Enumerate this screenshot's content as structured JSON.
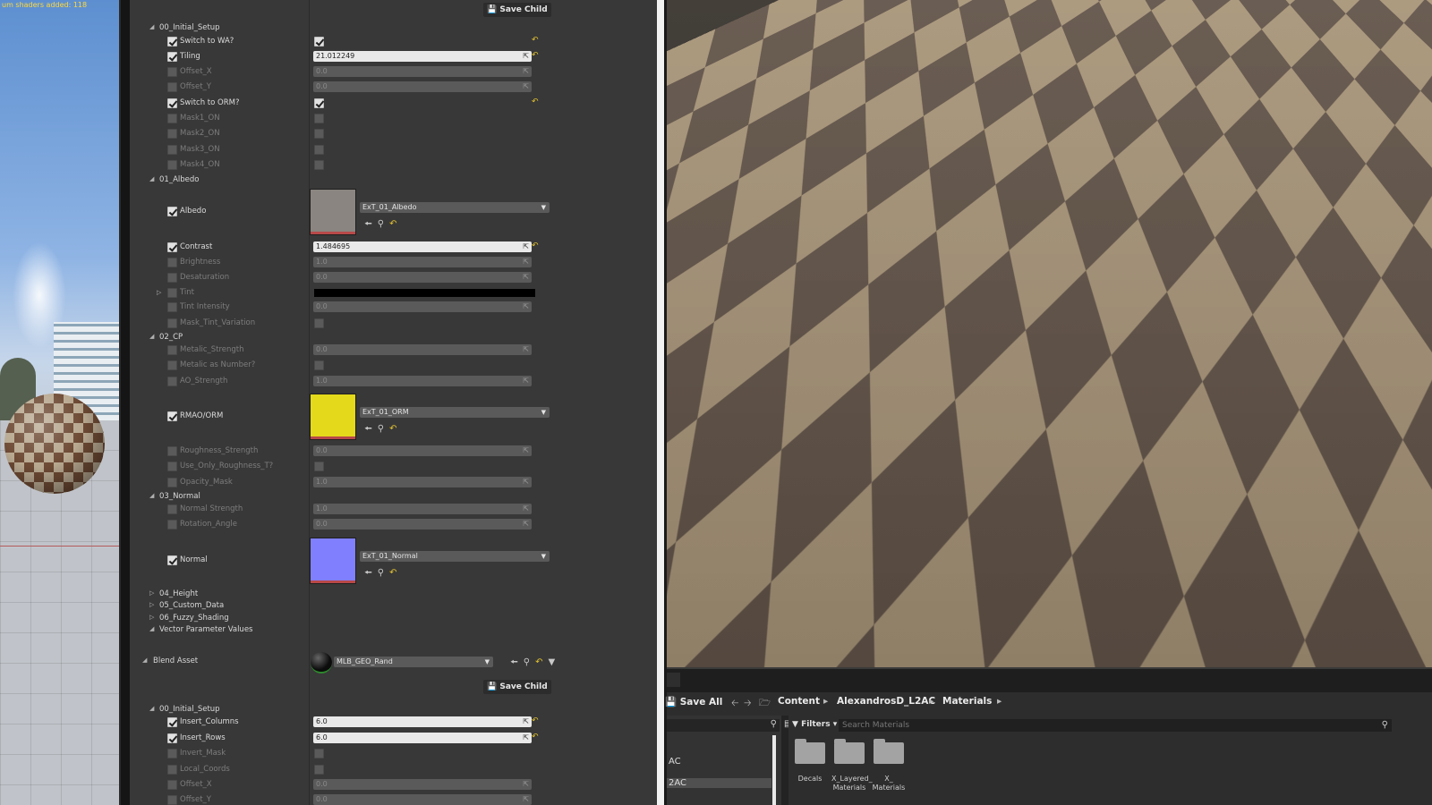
{
  "left_viewport": {
    "stat_text": "um shaders added: 118"
  },
  "details": {
    "save_child_label": "Save Child",
    "groups_top": {
      "initial_setup": "00_Initial_Setup",
      "albedo": "01_Albedo",
      "cp": "02_CP",
      "normal": "03_Normal",
      "height": "04_Height",
      "custom_data": "05_Custom_Data",
      "fuzzy_shading": "06_Fuzzy_Shading",
      "vector_params": "Vector Parameter Values"
    },
    "params": {
      "switch_to_wa": {
        "label": "Switch to WA?"
      },
      "tiling": {
        "label": "Tiling",
        "value": "21.012249"
      },
      "offset_x": {
        "label": "Offset_X",
        "value": "0.0"
      },
      "offset_y": {
        "label": "Offset_Y",
        "value": "0.0"
      },
      "switch_to_orm": {
        "label": "Switch to ORM?"
      },
      "mask1": {
        "label": "Mask1_ON"
      },
      "mask2": {
        "label": "Mask2_ON"
      },
      "mask3": {
        "label": "Mask3_ON"
      },
      "mask4": {
        "label": "Mask4_ON"
      },
      "albedo": {
        "label": "Albedo",
        "texture": "ExT_01_Albedo"
      },
      "contrast": {
        "label": "Contrast",
        "value": "1.484695"
      },
      "brightness": {
        "label": "Brightness",
        "value": "1.0"
      },
      "desaturation": {
        "label": "Desaturation",
        "value": "0.0"
      },
      "tint": {
        "label": "Tint"
      },
      "tint_intensity": {
        "label": "Tint Intensity",
        "value": "0.0"
      },
      "mask_tint_variation": {
        "label": "Mask_Tint_Variation"
      },
      "metalic_strength": {
        "label": "Metalic_Strength",
        "value": "0.0"
      },
      "metalic_as_number": {
        "label": "Metalic as Number?"
      },
      "ao_strength": {
        "label": "AO_Strength",
        "value": "1.0"
      },
      "rmao_orm": {
        "label": "RMAO/ORM",
        "texture": "ExT_01_ORM"
      },
      "roughness_strength": {
        "label": "Roughness_Strength",
        "value": "0.0"
      },
      "use_only_roughness": {
        "label": "Use_Only_Roughness_T?"
      },
      "opacity_mask": {
        "label": "Opacity_Mask",
        "value": "1.0"
      },
      "normal_strength": {
        "label": "Normal Strength",
        "value": "1.0"
      },
      "rotation_angle": {
        "label": "Rotation_Angle",
        "value": "0.0"
      },
      "normal": {
        "label": "Normal",
        "texture": "ExT_01_Normal"
      }
    },
    "blend_asset": {
      "label": "Blend Asset",
      "asset": "MLB_GEO_Rand"
    },
    "groups_bottom": {
      "initial_setup": "00_Initial_Setup"
    },
    "params_bottom": {
      "insert_columns": {
        "label": "Insert_Columns",
        "value": "6.0"
      },
      "insert_rows": {
        "label": "Insert_Rows",
        "value": "6.0"
      },
      "invert_mask": {
        "label": "Invert_Mask"
      },
      "local_coords": {
        "label": "Local_Coords"
      },
      "offset_x": {
        "label": "Offset_X",
        "value": "0.0"
      },
      "offset_y": {
        "label": "Offset_Y",
        "value": "0.0"
      }
    }
  },
  "content_browser": {
    "save_all": "Save All",
    "breadcrumb": [
      "Content",
      "AlexandrosD_L2AC",
      "Materials"
    ],
    "tree_nodes": [
      "AC",
      "2AC"
    ],
    "filters_label": "Filters",
    "search_placeholder": "Search Materials",
    "folders": [
      {
        "name": "Decals"
      },
      {
        "name": "X_Layered_ Materials"
      },
      {
        "name": "X_ Materials"
      }
    ]
  },
  "colors": {
    "reset_arrow": "#e0c030",
    "albedo_thumb": "#8a8580",
    "orm_thumb": "#e4d91a",
    "normal_thumb": "#8080ff"
  }
}
